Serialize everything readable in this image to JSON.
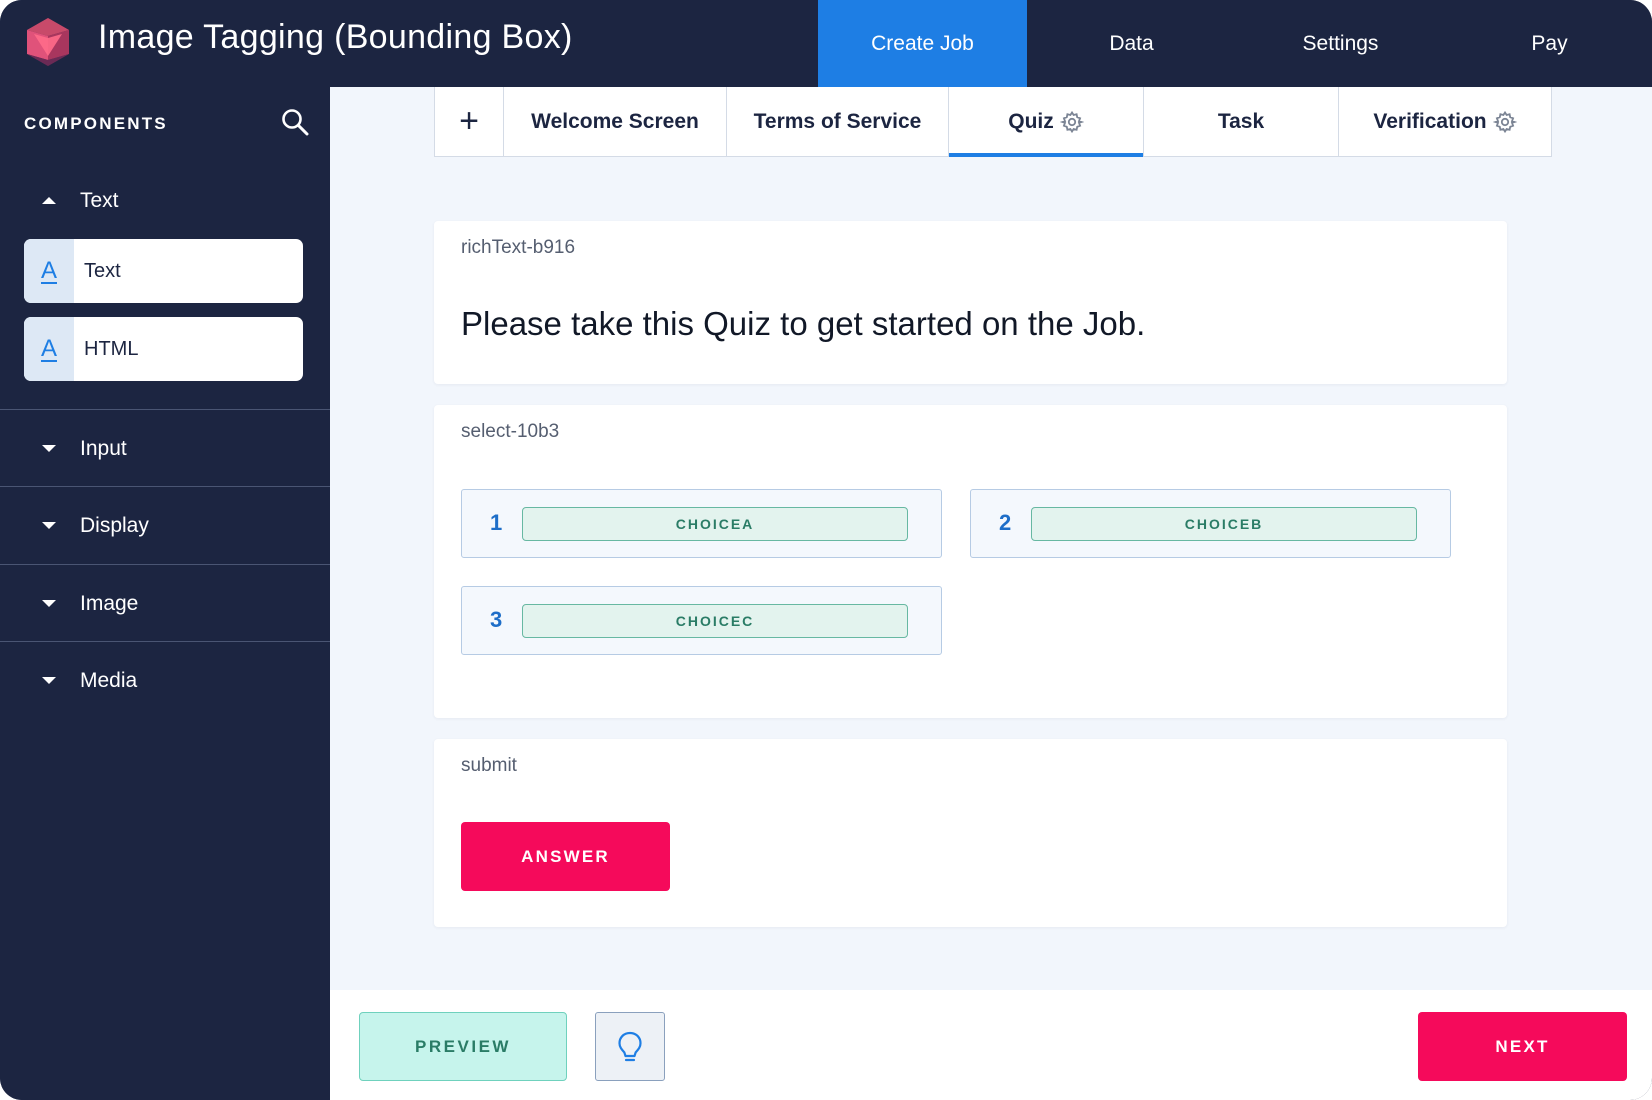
{
  "header": {
    "title": "Image Tagging (Bounding Box)",
    "logo_icon": "icosahedron-logo-icon",
    "nav": [
      {
        "label": "Create Job",
        "active": true
      },
      {
        "label": "Data",
        "active": false
      },
      {
        "label": "Settings",
        "active": false
      },
      {
        "label": "Pay",
        "active": false
      }
    ]
  },
  "sidebar": {
    "heading": "COMPONENTS",
    "search_icon": "search-icon",
    "sections": [
      {
        "label": "Text",
        "expanded": true,
        "items": [
          {
            "label": "Text",
            "icon": "text-format-icon",
            "icon_glyph": "A"
          },
          {
            "label": "HTML",
            "icon": "text-format-icon",
            "icon_glyph": "A"
          }
        ]
      },
      {
        "label": "Input",
        "expanded": false
      },
      {
        "label": "Display",
        "expanded": false
      },
      {
        "label": "Image",
        "expanded": false
      },
      {
        "label": "Media",
        "expanded": false
      }
    ]
  },
  "tabs": {
    "add_glyph": "+",
    "items": [
      {
        "label": "Welcome Screen",
        "has_gear": false,
        "active": false
      },
      {
        "label": "Terms of Service",
        "has_gear": false,
        "active": false
      },
      {
        "label": "Quiz",
        "has_gear": true,
        "active": true
      },
      {
        "label": "Task",
        "has_gear": false,
        "active": false
      },
      {
        "label": "Verification",
        "has_gear": true,
        "active": false
      }
    ]
  },
  "cards": {
    "rich_text": {
      "id": "richText-b916",
      "content": "Please take this Quiz to get started on the Job."
    },
    "select": {
      "id": "select-10b3",
      "choices": [
        {
          "number": "1",
          "label": "CHOICEA"
        },
        {
          "number": "2",
          "label": "CHOICEB"
        },
        {
          "number": "3",
          "label": "CHOICEC"
        }
      ]
    },
    "submit": {
      "id": "submit",
      "button_label": "ANSWER"
    }
  },
  "footer": {
    "preview_label": "PREVIEW",
    "bulb_icon": "lightbulb-icon",
    "next_label": "NEXT"
  },
  "colors": {
    "navy": "#1c2541",
    "accent_blue": "#1e7ee4",
    "primary_pink": "#f50a5b",
    "teal_light": "#c6f4ec",
    "page_bg": "#f2f6fc"
  }
}
